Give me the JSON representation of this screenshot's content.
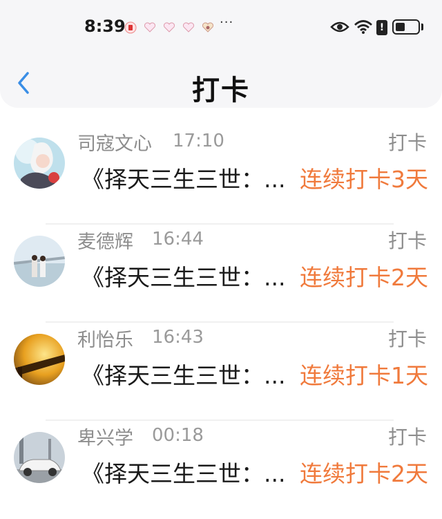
{
  "status_bar": {
    "time": "8:39",
    "dots": "···",
    "alert": "!",
    "icons": [
      "notification-badge-icon",
      "heart-icon",
      "heart-icon",
      "heart-icon",
      "heart-avatar-icon",
      "eye-icon",
      "wifi-icon",
      "alert-icon",
      "battery-icon"
    ]
  },
  "header": {
    "title": "打卡",
    "back_icon": "chevron-left-icon"
  },
  "colors": {
    "accent_orange": "#f07a3c",
    "back_blue": "#3a8ee6",
    "muted_text": "#8d8d8d"
  },
  "entries": [
    {
      "name": "司寇文心",
      "time": "17:10",
      "tag": "打卡",
      "message": "《择天三生三世：...",
      "streak": "连续打卡3天"
    },
    {
      "name": "麦德辉",
      "time": "16:44",
      "tag": "打卡",
      "message": "《择天三生三世：...",
      "streak": "连续打卡2天"
    },
    {
      "name": "利怡乐",
      "time": "16:43",
      "tag": "打卡",
      "message": "《择天三生三世：...",
      "streak": "连续打卡1天"
    },
    {
      "name": "卑兴学",
      "time": "00:18",
      "tag": "打卡",
      "message": "《择天三生三世：...",
      "streak": "连续打卡2天"
    }
  ]
}
